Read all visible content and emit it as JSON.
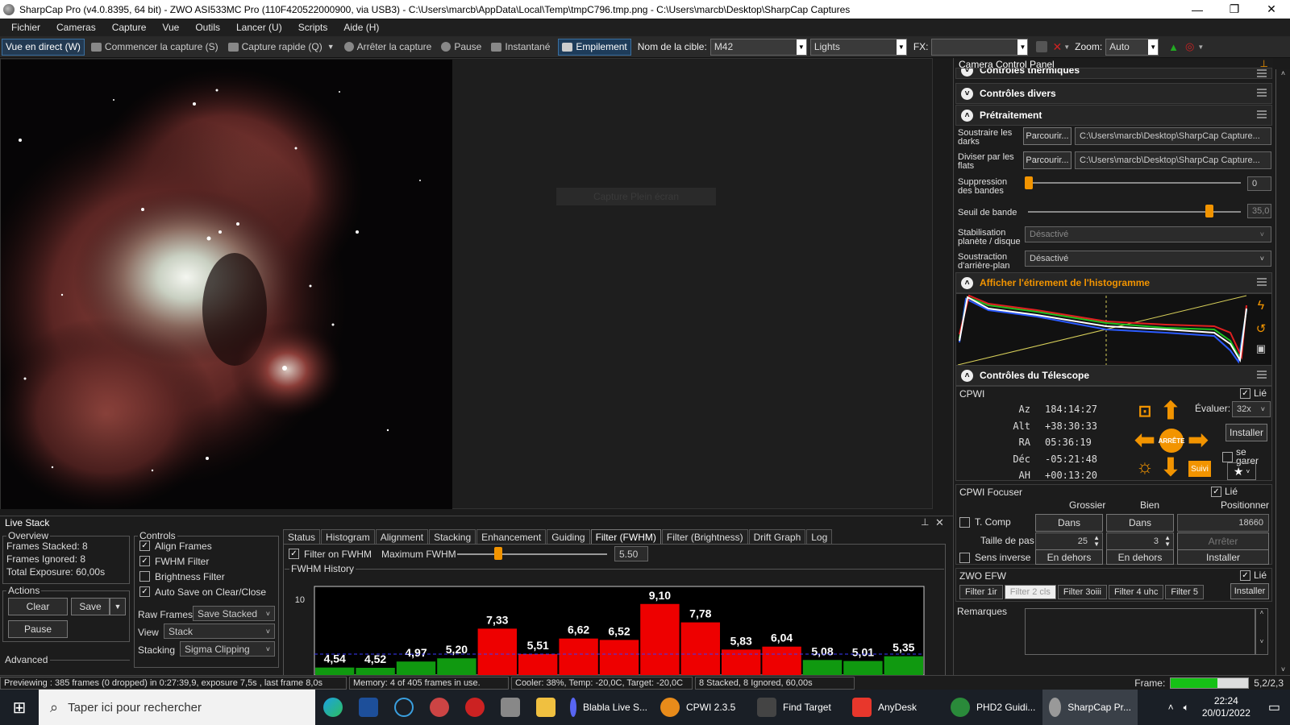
{
  "window": {
    "title": "SharpCap Pro (v4.0.8395, 64 bit) - ZWO ASI533MC Pro (110F420522000900, via USB3) - C:\\Users\\marcb\\AppData\\Local\\Temp\\tmpC796.tmp.png - C:\\Users\\marcb\\Desktop\\SharpCap Captures",
    "minimize": "—",
    "maximize": "❐",
    "close": "✕"
  },
  "menu": [
    "Fichier",
    "Cameras",
    "Capture",
    "Vue",
    "Outils",
    "Lancer (U)",
    "Scripts",
    "Aide (H)"
  ],
  "toolbar": {
    "live_view": "Vue en direct (W)",
    "start_capture": "Commencer la capture (S)",
    "quick_capture": "Capture rapide (Q)",
    "stop_capture": "Arrêter la capture",
    "pause": "Pause",
    "snapshot": "Instantané",
    "stacking": "Empilement",
    "target_label": "Nom de la cible:",
    "target_value": "M42",
    "frame_type": "Lights",
    "fx_label": "FX:",
    "fx_value": "",
    "zoom_label": "Zoom:",
    "zoom_value": "Auto"
  },
  "viewer": {
    "overlay_button": "Capture Plein écran"
  },
  "camera_panel": {
    "title": "Camera Control Panel",
    "sections": {
      "thermal": "Contrôles thermiques",
      "misc": "Contrôles divers",
      "preprocessing": "Prétraitement",
      "histogram": "Afficher l'étirement de l'histogramme",
      "telescope": "Contrôles du Télescope"
    },
    "preprocessing": {
      "dark_label": "Soustraire les darks",
      "flat_label": "Diviser par les flats",
      "browse": "Parcourir...",
      "dark_path": "C:\\Users\\marcb\\Desktop\\SharpCap Capture...",
      "flat_path": "C:\\Users\\marcb\\Desktop\\SharpCap Capture...",
      "banding_label": "Suppression des bandes",
      "banding_value": "0",
      "banding_level": 0,
      "band_threshold_label": "Seuil de bande",
      "band_threshold_value": "35,0",
      "band_threshold_level": 0.85,
      "planet_label": "Stabilisation planète / disque",
      "planet_value": "Désactivé",
      "bg_label": "Soustraction d'arrière-plan",
      "bg_value": "Désactivé"
    }
  },
  "telescope": {
    "name": "CPWI",
    "linked_label": "Lié",
    "az_label": "Az",
    "az": "184:14:27",
    "alt_label": "Alt",
    "alt": "+38:30:33",
    "ra_label": "RA",
    "ra": "05:36:19",
    "dec_label": "Déc",
    "dec": "-05:21:48",
    "ah_label": "AH",
    "ah": "+00:13:20",
    "rate_label": "Évaluer:",
    "rate_value": "32x",
    "install": "Installer",
    "park": "se garer",
    "stop": "ARRÊTE",
    "track": "Suivi"
  },
  "focuser": {
    "name": "CPWI Focuser",
    "linked_label": "Lié",
    "coarse": "Grossier",
    "fine": "Bien",
    "position": "Positionner",
    "tcomp": "T. Comp",
    "in": "Dans",
    "position_value": "18660",
    "step_label": "Taille de pas",
    "coarse_step": "25",
    "fine_step": "3",
    "stop": "Arrêter",
    "reverse": "Sens inverse",
    "out": "En dehors",
    "install": "Installer"
  },
  "efw": {
    "name": "ZWO EFW",
    "linked_label": "Lié",
    "filters": [
      "Filter 1ir",
      "Filter 2 cls",
      "Filter 3oiii",
      "Filter 4 uhc",
      "Filter 5"
    ],
    "install": "Installer",
    "notes_label": "Remarques"
  },
  "livestack": {
    "title": "Live Stack",
    "overview_label": "Overview",
    "frames_stacked_label": "Frames Stacked:",
    "frames_stacked": "8",
    "frames_ignored_label": "Frames Ignored:",
    "frames_ignored": "8",
    "total_exposure_label": "Total Exposure:",
    "total_exposure": "60,00s",
    "actions_label": "Actions",
    "clear": "Clear",
    "save": "Save",
    "pause": "Pause",
    "advanced": "Advanced",
    "controls_label": "Controls",
    "align_frames": "Align Frames",
    "fwhm_filter": "FWHM Filter",
    "brightness_filter": "Brightness Filter",
    "auto_save": "Auto Save on Clear/Close",
    "raw_frames_label": "Raw Frames",
    "raw_frames_value": "Save Stacked",
    "view_label": "View",
    "view_value": "Stack",
    "stacking_label": "Stacking",
    "stacking_value": "Sigma Clipping",
    "tabs": [
      "Status",
      "Histogram",
      "Alignment",
      "Stacking",
      "Enhancement",
      "Guiding",
      "Filter (FWHM)",
      "Filter (Brightness)",
      "Drift Graph",
      "Log"
    ],
    "filter_on_fwhm": "Filter on FWHM",
    "max_fwhm_label": "Maximum FWHM",
    "max_fwhm_value": "5.50",
    "history_label": "FWHM History"
  },
  "chart_data": {
    "type": "bar",
    "title": "FWHM History",
    "ylim_top": 10,
    "threshold": 5.5,
    "y_tick": "10",
    "values": [
      4.54,
      4.52,
      4.97,
      5.2,
      7.33,
      5.51,
      6.62,
      6.52,
      9.1,
      7.78,
      5.83,
      6.04,
      5.08,
      5.01,
      5.35
    ],
    "labels": [
      "4,54",
      "4,52",
      "4,97",
      "5,20",
      "7,33",
      "5,51",
      "6,62",
      "6,52",
      "9,10",
      "7,78",
      "5,83",
      "6,04",
      "5,08",
      "5,01",
      "5,35"
    ],
    "colors": {
      "accepted": "#109910",
      "rejected": "#ee0000"
    }
  },
  "status": {
    "preview": "Previewing : 385 frames (0 dropped) in 0:27:39,9, exposure 7,5s , last frame 8,0s",
    "memory": "Memory: 4 of 405 frames in use.",
    "cooler": "Cooler: 38%, Temp: -20,0C, Target: -20,0C",
    "stacked": "8 Stacked, 8 Ignored, 60,00s",
    "frame_label": "Frame:",
    "frame_value": "5,2/2,3",
    "frame_progress": 0.6
  },
  "taskbar": {
    "search_placeholder": "Taper ici pour rechercher",
    "apps": [
      "Blabla Live S...",
      "CPWI 2.3.5",
      "Find Target",
      "AnyDesk",
      "PHD2 Guidi...",
      "SharpCap Pr..."
    ],
    "time": "22:24",
    "date": "20/01/2022"
  },
  "colors": {
    "accent": "#f29400",
    "selected_blue": "#1e3c5a"
  }
}
